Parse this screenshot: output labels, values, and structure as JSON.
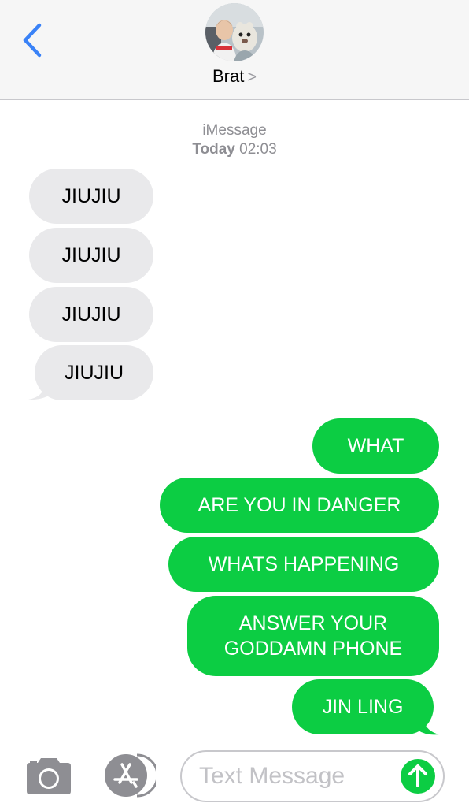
{
  "header": {
    "contact_name": "Brat",
    "chevron": ">",
    "back_icon": "chevron-left-icon",
    "accent_color": "#3a82f7"
  },
  "thread": {
    "service": "iMessage",
    "date_label": "Today",
    "time": "02:03"
  },
  "messages": [
    {
      "from": "contact",
      "text": "JIUJIU"
    },
    {
      "from": "contact",
      "text": "JIUJIU"
    },
    {
      "from": "contact",
      "text": "JIUJIU"
    },
    {
      "from": "contact",
      "text": "JIUJIU"
    },
    {
      "from": "me",
      "text": "WHAT"
    },
    {
      "from": "me",
      "text": "ARE YOU IN DANGER"
    },
    {
      "from": "me",
      "text": "WHATS HAPPENING"
    },
    {
      "from": "me",
      "text": "ANSWER YOUR GODDAMN PHONE"
    },
    {
      "from": "me",
      "text": "JIN LING"
    }
  ],
  "composer": {
    "placeholder": "Text Message",
    "camera_icon": "camera-icon",
    "apps_icon": "app-store-icon",
    "send_icon": "arrow-up-icon",
    "outgoing_color": "#0ccd43",
    "incoming_color": "#e9e9eb"
  }
}
